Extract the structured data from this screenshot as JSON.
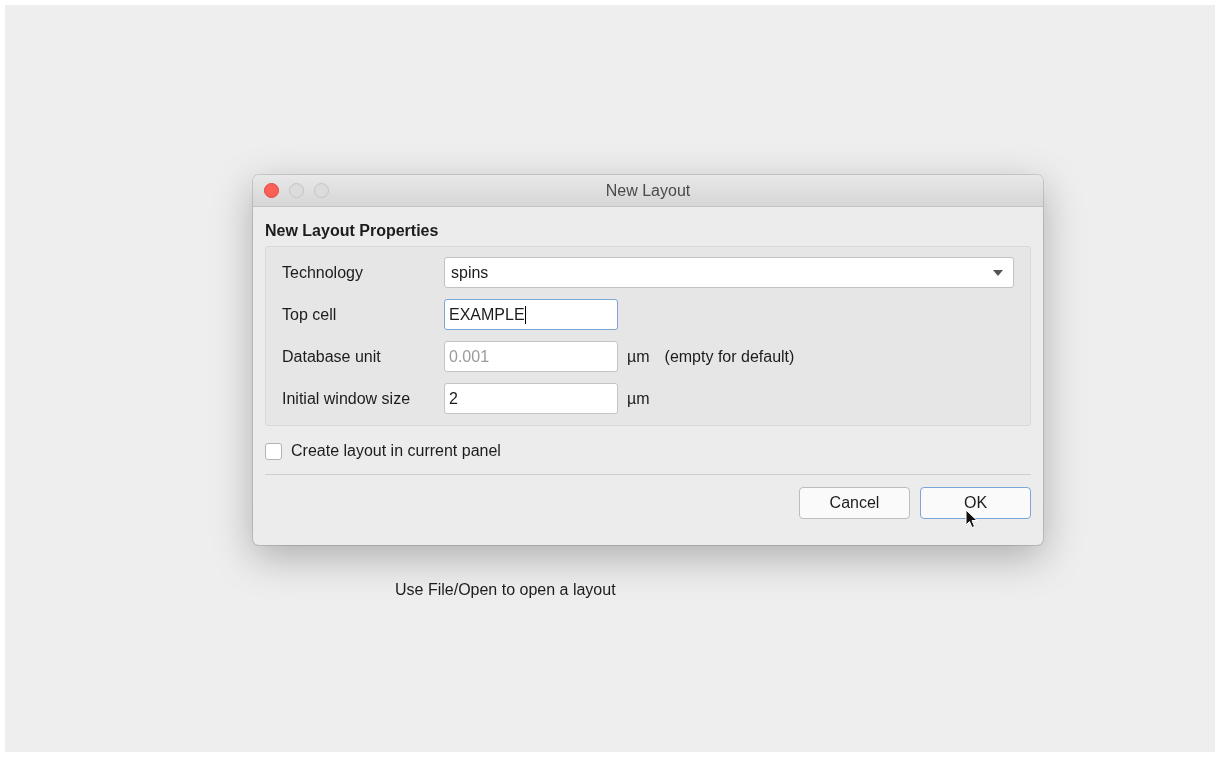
{
  "window": {
    "title": "New Layout"
  },
  "group": {
    "title": "New Layout Properties"
  },
  "fields": [
    {
      "kind": "combo",
      "label": "Technology",
      "value": "spins"
    },
    {
      "kind": "input",
      "label": "Top cell",
      "value": "EXAMPLE",
      "focused": true
    },
    {
      "kind": "input",
      "label": "Database unit",
      "placeholder": "0.001",
      "unit": "µm",
      "hint": "(empty for default)",
      "focused": false
    },
    {
      "kind": "input",
      "label": "Initial window size",
      "value": "2",
      "unit": "µm",
      "focused": false
    }
  ],
  "checkbox": {
    "label": "Create layout in current panel",
    "checked": false
  },
  "buttons": [
    {
      "label": "Cancel",
      "default": false
    },
    {
      "label": "OK",
      "default": true
    }
  ],
  "message": "Use File/Open to open a layout"
}
